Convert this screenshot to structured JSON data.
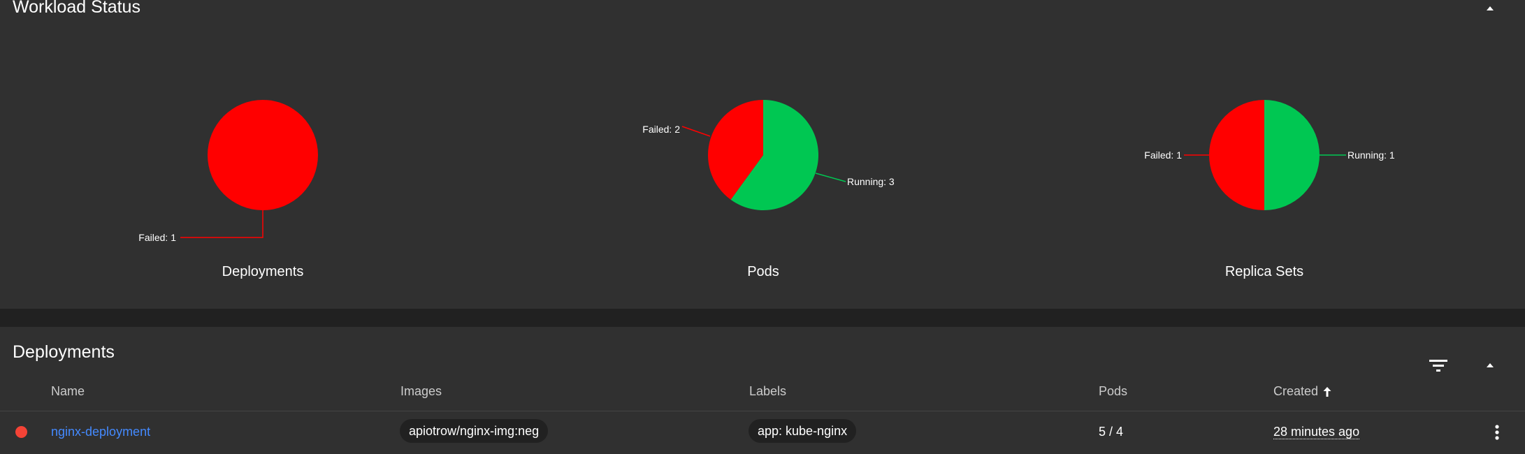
{
  "workload": {
    "title": "Workload Status",
    "charts": [
      {
        "caption": "Deployments",
        "chart_data": {
          "type": "pie",
          "slices": [
            {
              "label": "Failed",
              "value": 1,
              "color": "#ff0000"
            }
          ]
        },
        "labels": [
          "Failed: 1"
        ]
      },
      {
        "caption": "Pods",
        "chart_data": {
          "type": "pie",
          "slices": [
            {
              "label": "Running",
              "value": 3,
              "color": "#00c752"
            },
            {
              "label": "Failed",
              "value": 2,
              "color": "#ff0000"
            }
          ]
        },
        "labels": [
          "Running: 3",
          "Failed: 2"
        ]
      },
      {
        "caption": "Replica Sets",
        "chart_data": {
          "type": "pie",
          "slices": [
            {
              "label": "Running",
              "value": 1,
              "color": "#00c752"
            },
            {
              "label": "Failed",
              "value": 1,
              "color": "#ff0000"
            }
          ]
        },
        "labels": [
          "Running: 1",
          "Failed: 1"
        ]
      }
    ]
  },
  "deployments": {
    "title": "Deployments",
    "columns": {
      "name": "Name",
      "images": "Images",
      "labels": "Labels",
      "pods": "Pods",
      "created": "Created"
    },
    "rows": [
      {
        "status_color": "#f44336",
        "name": "nginx-deployment",
        "image": "apiotrow/nginx-img:neg",
        "label": "app: kube-nginx",
        "pods": "5 / 4",
        "created": "28 minutes ago"
      }
    ]
  },
  "icons": {
    "collapse": "chevron-up-icon",
    "filter": "filter-icon",
    "sort": "arrow-up-icon",
    "more": "more-vert-icon"
  }
}
